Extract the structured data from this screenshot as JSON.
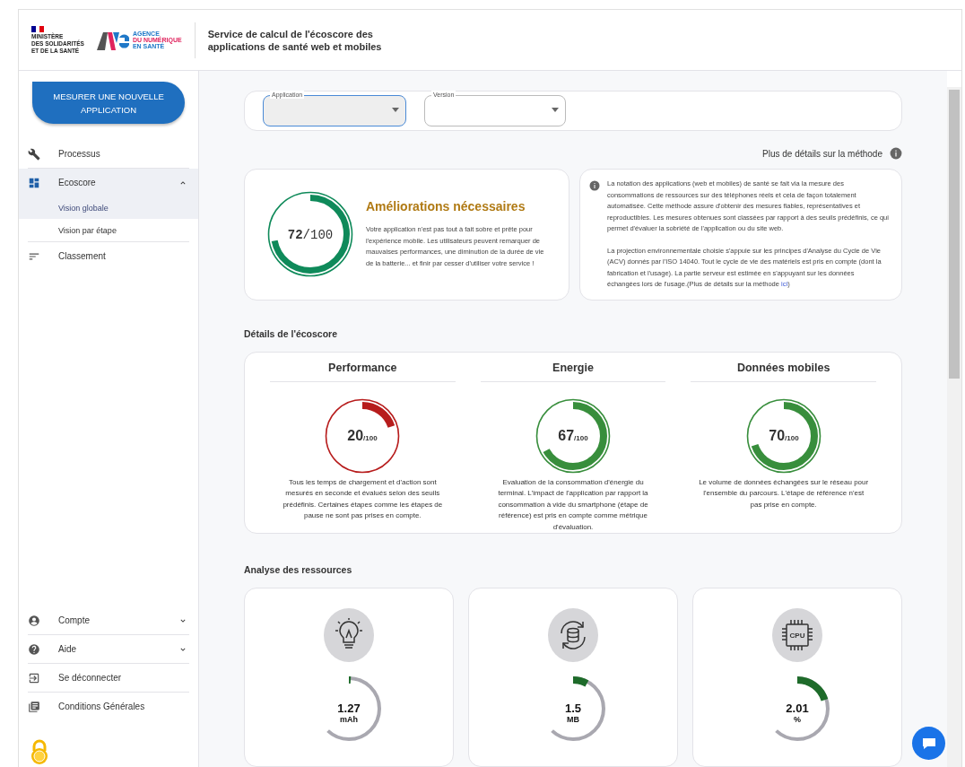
{
  "header": {
    "ministry_lines": [
      "MINISTÈRE",
      "DES SOLIDARITÉS",
      "ET DE LA SANTÉ"
    ],
    "agency_lines": [
      "AGENCE",
      "DU NUMÉRIQUE",
      "EN SANTÉ"
    ],
    "title": "Service de calcul de l'écoscore des applications de santé web et mobiles"
  },
  "sidebar": {
    "action_button": "MESURER UNE NOUVELLE APPLICATION",
    "items": [
      {
        "label": "Processus",
        "kind": "wrench",
        "selected": false
      },
      {
        "label": "Ecoscore",
        "kind": "dashboard",
        "expanded": true,
        "children": [
          {
            "label": "Vision globale",
            "selected": true
          },
          {
            "label": "Vision par étape",
            "selected": false
          }
        ]
      },
      {
        "label": "Classement",
        "kind": "sort",
        "selected": false
      }
    ],
    "bottom_items": [
      {
        "label": "Compte",
        "kind": "account",
        "expanded": false
      },
      {
        "label": "Aide",
        "kind": "help",
        "expanded": false
      },
      {
        "label": "Se déconnecter",
        "kind": "logout"
      },
      {
        "label": "Conditions Générales",
        "kind": "library"
      }
    ]
  },
  "filters": [
    {
      "label": "Application",
      "focused": true
    },
    {
      "label": "Version",
      "focused": false
    }
  ],
  "method_link": "Plus de détails sur la méthode",
  "summary": {
    "score": "72",
    "total": "/100",
    "level": 0.72,
    "title": "Améliorations nécessaires",
    "text": "Votre application n'est pas tout à fait sobre et prête pour l'expérience mobile. Les utilisateurs peuvent remarquer de mauvaises performances, une diminution de la durée de vie de la batterie... et finir par cesser d'utiliser votre service !"
  },
  "info": {
    "paragraph": "La notation des applications (web et mobiles) de santé se fait via la mesure des consommations de ressources sur des téléphones réels et cela de façon totalement automatisée. Cette méthode assure d'obtenir des mesures fiables, représentatives et reproductibles. Les mesures obtenues sont classées par rapport à des seuils prédéfinis, ce qui permet d'évaluer la sobriété de l'application ou du site web.",
    "paragraph2": "La projection environnementale choisie s'appuie sur les principes d'Analyse du Cycle de Vie (ACV) donnés par l'ISO 14040. Tout le cycle de vie des matériels est pris en compte (dont la fabrication et l'usage). La partie serveur est estimée en s'appuyant sur les données échangées lors de l'usage.(Plus de détails sur la méthode ",
    "link": "ici",
    "paragraph2_end": ")"
  },
  "details": {
    "heading": "Détails de l'écoscore",
    "metrics": [
      {
        "title": "Performance",
        "score": "20",
        "total": "/100",
        "level": 0.2,
        "color": "#b71c1c",
        "text": "Tous les temps de chargement et d'action sont mesurés en seconde et évalués selon des seuils prédéfinis. Certaines étapes comme les étapes de pause ne sont pas prises en compte."
      },
      {
        "title": "Energie",
        "score": "67",
        "total": "/100",
        "level": 0.67,
        "color": "#388e3c",
        "text": "Evaluation de la consommation d'énergie du terminal. L'impact de l'application par rapport la consommation à vide du smartphone (étape de référence) est pris en compte comme métrique d'évaluation."
      },
      {
        "title": "Données mobiles",
        "score": "70",
        "total": "/100",
        "level": 0.7,
        "color": "#388e3c",
        "text": "Le volume de données échangées sur le réseau pour l'ensemble du parcours. L'étape de référence n'est pas prise en compte."
      }
    ]
  },
  "resources": {
    "heading": "Analyse des ressources",
    "items": [
      {
        "kind": "bulb",
        "value": "1.27",
        "unit": "mAh",
        "level": 0.01
      },
      {
        "kind": "sync",
        "value": "1.5",
        "unit": "MB",
        "level": 0.08
      },
      {
        "kind": "cpu",
        "chip_label": "CPU",
        "value": "2.01",
        "unit": "%",
        "level": 0.2
      }
    ]
  }
}
